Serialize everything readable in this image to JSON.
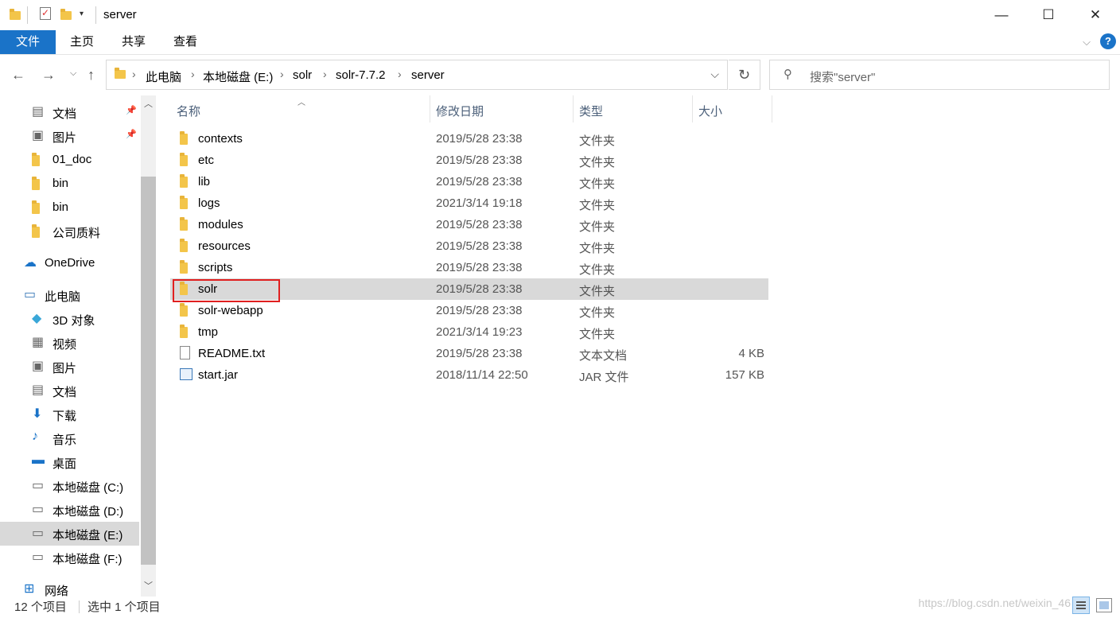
{
  "window": {
    "title": "server",
    "controls": {
      "minimize": "—",
      "maximize": "☐",
      "close": "✕"
    }
  },
  "ribbon": {
    "tabs": [
      {
        "label": "文件",
        "active": true
      },
      {
        "label": "主页"
      },
      {
        "label": "共享"
      },
      {
        "label": "查看"
      }
    ]
  },
  "address": {
    "crumbs": [
      "此电脑",
      "本地磁盘 (E:)",
      "solr",
      "solr-7.7.2",
      "server"
    ]
  },
  "search": {
    "placeholder": "搜索\"server\""
  },
  "sidebar": {
    "items": [
      {
        "label": "文档",
        "icon": "document-icon",
        "pinned": true
      },
      {
        "label": "图片",
        "icon": "picture-icon",
        "pinned": true
      },
      {
        "label": "01_doc",
        "icon": "folder-icon"
      },
      {
        "label": "bin",
        "icon": "folder-icon"
      },
      {
        "label": "bin",
        "icon": "folder-icon"
      },
      {
        "label": "公司质料",
        "icon": "folder-icon"
      },
      {
        "label": "OneDrive",
        "icon": "cloud-icon"
      },
      {
        "label": "此电脑",
        "icon": "computer-icon"
      },
      {
        "label": "3D 对象",
        "icon": "cube-icon"
      },
      {
        "label": "视频",
        "icon": "video-icon"
      },
      {
        "label": "图片",
        "icon": "picture-icon"
      },
      {
        "label": "文档",
        "icon": "document-icon"
      },
      {
        "label": "下载",
        "icon": "download-icon"
      },
      {
        "label": "音乐",
        "icon": "music-icon"
      },
      {
        "label": "桌面",
        "icon": "desktop-icon"
      },
      {
        "label": "本地磁盘 (C:)",
        "icon": "drive-icon"
      },
      {
        "label": "本地磁盘 (D:)",
        "icon": "drive-icon"
      },
      {
        "label": "本地磁盘 (E:)",
        "icon": "drive-icon",
        "selected": true
      },
      {
        "label": "本地磁盘 (F:)",
        "icon": "drive-icon"
      },
      {
        "label": "网络",
        "icon": "network-icon"
      }
    ]
  },
  "columns": {
    "name": "名称",
    "date": "修改日期",
    "type": "类型",
    "size": "大小"
  },
  "files": [
    {
      "name": "contexts",
      "date": "2019/5/28 23:38",
      "type": "文件夹",
      "size": "",
      "icon": "folder-icon"
    },
    {
      "name": "etc",
      "date": "2019/5/28 23:38",
      "type": "文件夹",
      "size": "",
      "icon": "folder-icon"
    },
    {
      "name": "lib",
      "date": "2019/5/28 23:38",
      "type": "文件夹",
      "size": "",
      "icon": "folder-icon"
    },
    {
      "name": "logs",
      "date": "2021/3/14 19:18",
      "type": "文件夹",
      "size": "",
      "icon": "folder-icon"
    },
    {
      "name": "modules",
      "date": "2019/5/28 23:38",
      "type": "文件夹",
      "size": "",
      "icon": "folder-icon"
    },
    {
      "name": "resources",
      "date": "2019/5/28 23:38",
      "type": "文件夹",
      "size": "",
      "icon": "folder-icon"
    },
    {
      "name": "scripts",
      "date": "2019/5/28 23:38",
      "type": "文件夹",
      "size": "",
      "icon": "folder-icon"
    },
    {
      "name": "solr",
      "date": "2019/5/28 23:38",
      "type": "文件夹",
      "size": "",
      "icon": "folder-icon",
      "selected": true
    },
    {
      "name": "solr-webapp",
      "date": "2019/5/28 23:38",
      "type": "文件夹",
      "size": "",
      "icon": "folder-icon"
    },
    {
      "name": "tmp",
      "date": "2021/3/14 19:23",
      "type": "文件夹",
      "size": "",
      "icon": "folder-icon"
    },
    {
      "name": "README.txt",
      "date": "2019/5/28 23:38",
      "type": "文本文档",
      "size": "4 KB",
      "icon": "text-file-icon"
    },
    {
      "name": "start.jar",
      "date": "2018/11/14 22:50",
      "type": "JAR 文件",
      "size": "157 KB",
      "icon": "jar-file-icon"
    }
  ],
  "status": {
    "count": "12 个项目",
    "selection": "选中 1 个项目"
  },
  "watermark": "https://blog.csdn.net/weixin_46",
  "colors": {
    "accent": "#1a73c8",
    "selection": "#d9d9d9",
    "highlight_box": "#e02020",
    "folder": "#f3c54a"
  }
}
